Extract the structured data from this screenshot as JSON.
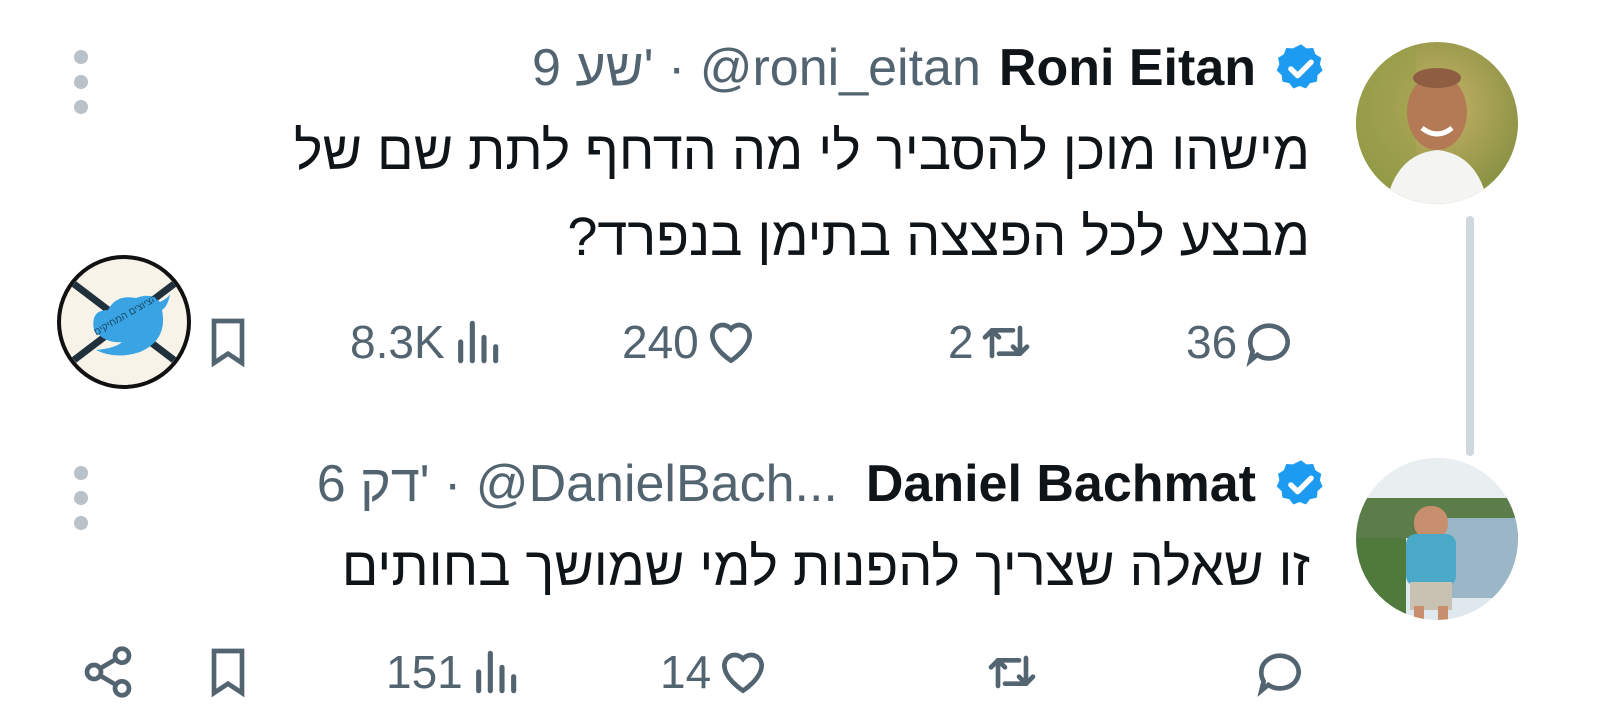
{
  "tweets": [
    {
      "name": "Roni Eitan",
      "meta": "9 שע' · @roni_eitan",
      "lines": [
        "מישהו מוכן להסביר לי מה הדחף לתת שם של",
        "מבצע לכל הפצצה בתימן בנפרד?"
      ],
      "actions": {
        "replies": "36",
        "retweets": "2",
        "likes": "240",
        "views": "8.3K"
      }
    },
    {
      "name": "Daniel Bachmat",
      "meta": "6 דק' · @DanielBach...",
      "lines": [
        "זו שאלה שצריך להפנות למי שמושך בחותים"
      ],
      "actions": {
        "replies": "",
        "retweets": "",
        "likes": "14",
        "views": "151"
      }
    }
  ],
  "badge_text": "הציוצים המחיקים",
  "colors": {
    "verified": "#1d9bf0",
    "text": "#0f1419",
    "muted": "#536471",
    "thread_line": "#cfd9de",
    "twitter_blue": "#3aa3e3"
  },
  "icons": [
    "verified-icon",
    "more-icon",
    "reply-icon",
    "retweet-icon",
    "like-icon",
    "views-icon",
    "bookmark-icon",
    "share-icon",
    "twitter-bird-icon"
  ]
}
